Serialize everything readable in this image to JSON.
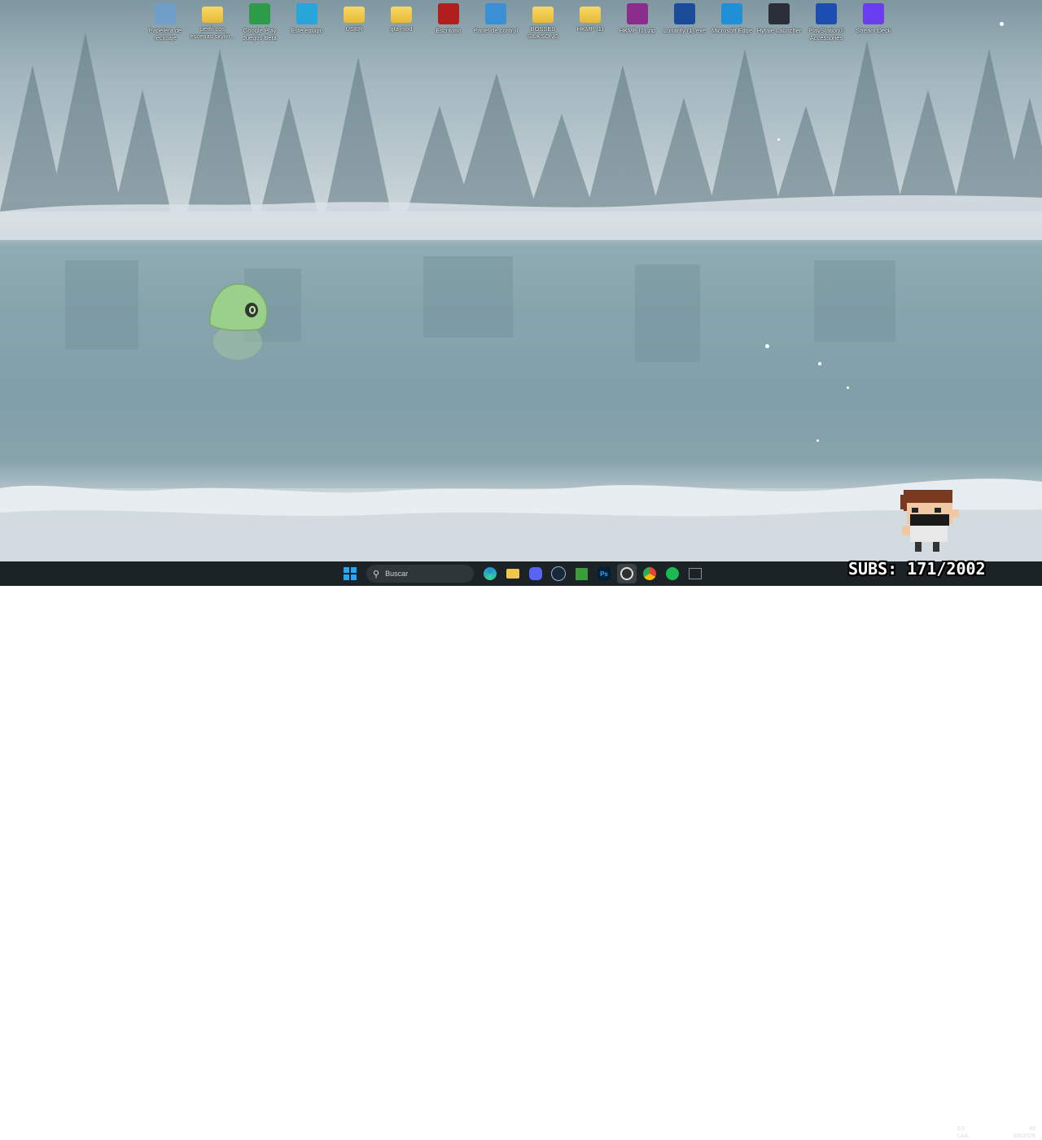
{
  "desktop": {
    "icons": [
      {
        "label": "Papelera de reciclaje",
        "icon": "recycle-bin-icon",
        "color": "#6f9fc8"
      },
      {
        "label": "perfil cos escenas skylin...",
        "icon": "folder-icon",
        "color": "#efc74a"
      },
      {
        "label": "Google Play Juegos Beta",
        "icon": "google-play-games-icon",
        "color": "#2e9b4a"
      },
      {
        "label": "Este equipo",
        "icon": "monitor-icon",
        "color": "#26a6d9"
      },
      {
        "label": "USER",
        "icon": "user-folder-icon",
        "color": "#efc74a"
      },
      {
        "label": "gta mod",
        "icon": "folder-icon",
        "color": "#efc74a"
      },
      {
        "label": "Escritorio",
        "icon": "desktop-folder-icon",
        "color": "#b01e1e"
      },
      {
        "label": "Panel de control",
        "icon": "control-panel-icon",
        "color": "#3b8fd4"
      },
      {
        "label": "BOSSES SILKSONG",
        "icon": "folder-icon",
        "color": "#efc74a"
      },
      {
        "label": "HKMP (1)",
        "icon": "folder-zip-icon",
        "color": "#efc74a"
      },
      {
        "label": "HKMP (1).zip",
        "icon": "winrar-icon",
        "color": "#8b2d8b"
      },
      {
        "label": "Lunarify (1).exe",
        "icon": "lunar-icon",
        "color": "#1b4c9a"
      },
      {
        "label": "Microsoft Edge",
        "icon": "edge-icon",
        "color": "#1f8fd6"
      },
      {
        "label": "Hytale Launcher",
        "icon": "hytale-icon",
        "color": "#2b2f3a"
      },
      {
        "label": "PlayStation® Accessories",
        "icon": "playstation-icon",
        "color": "#1d4fb3"
      },
      {
        "label": "Stream Deck",
        "icon": "stream-deck-icon",
        "color": "#6a3df0"
      }
    ]
  },
  "taskbar": {
    "search_placeholder": "Buscar",
    "apps": [
      {
        "name": "start-button",
        "icon": "windows-icon",
        "color": "#2aa4f4"
      },
      {
        "name": "edge-taskbar",
        "icon": "edge-icon",
        "color": "#1f8fd6"
      },
      {
        "name": "explorer-taskbar",
        "icon": "folder-icon",
        "color": "#efc74a"
      },
      {
        "name": "discord-taskbar",
        "icon": "discord-icon",
        "color": "#5865f2"
      },
      {
        "name": "steam-taskbar",
        "icon": "steam-icon",
        "color": "#1b2838"
      },
      {
        "name": "minecraft-taskbar",
        "icon": "minecraft-icon",
        "color": "#3a9d3a"
      },
      {
        "name": "photoshop-taskbar",
        "icon": "photoshop-icon",
        "color": "#001e36"
      },
      {
        "name": "obs-taskbar",
        "icon": "obs-icon",
        "color": "#302e31"
      },
      {
        "name": "chrome-taskbar",
        "icon": "chrome-icon",
        "color": "#e94335"
      },
      {
        "name": "spotify-taskbar",
        "icon": "spotify-icon",
        "color": "#1db954"
      },
      {
        "name": "snipping-taskbar",
        "icon": "snipping-tool-icon",
        "color": "#5a5f63"
      }
    ],
    "lang": "ES\nLAA",
    "time": "48",
    "date": "6/6/2026"
  },
  "overlay": {
    "subs_text": "SUBS: 171/2002"
  }
}
